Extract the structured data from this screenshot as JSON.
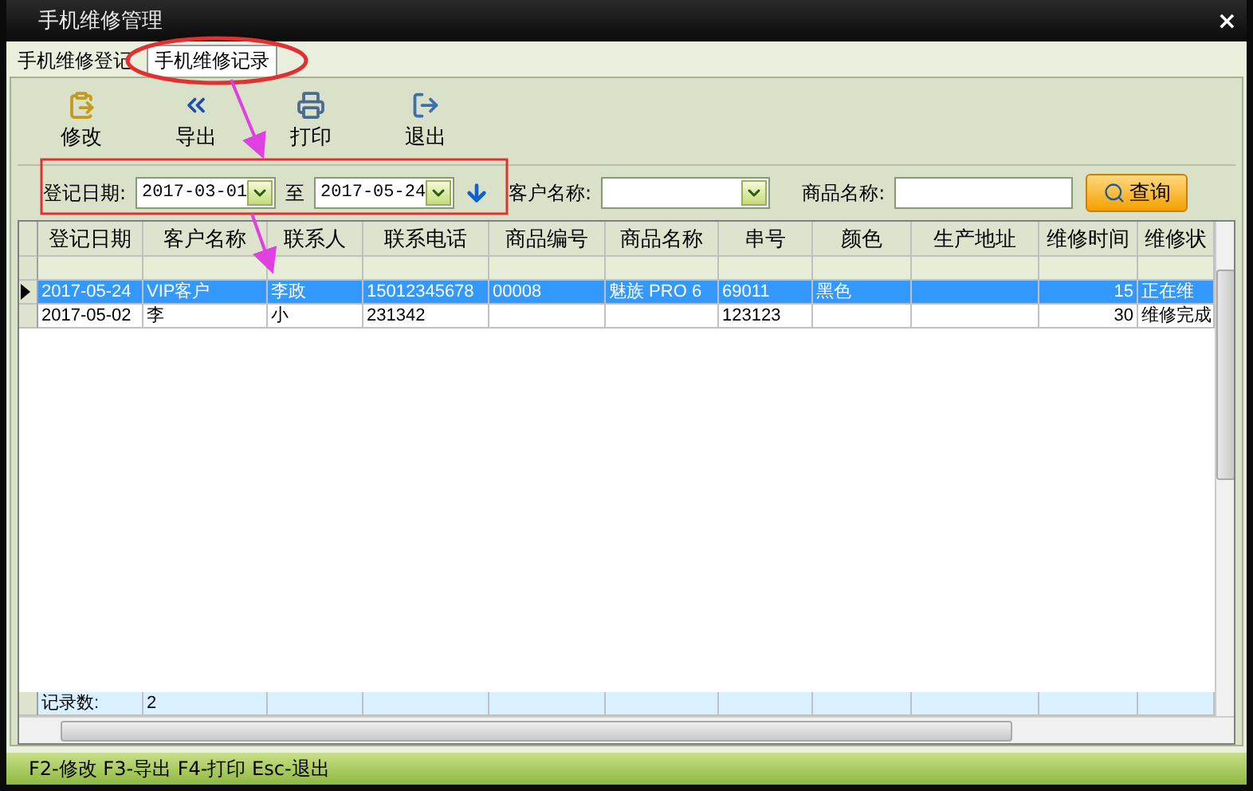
{
  "window": {
    "title": "手机维修管理",
    "close": "×"
  },
  "tabs": [
    {
      "label": "手机维修登记",
      "selected": false
    },
    {
      "label": "手机维修记录",
      "selected": true
    }
  ],
  "toolbar": [
    {
      "kind": "edit",
      "label": "修改"
    },
    {
      "kind": "export",
      "label": "导出"
    },
    {
      "kind": "print",
      "label": "打印"
    },
    {
      "kind": "exit",
      "label": "退出"
    }
  ],
  "filter": {
    "date_label": "登记日期:",
    "date_from": "2017-03-01",
    "to_label": "至",
    "date_to": "2017-05-24",
    "customer_label": "客户名称:",
    "product_label": "商品名称:",
    "search_button": "查询"
  },
  "table": {
    "columns": [
      "登记日期",
      "客户名称",
      "联系人",
      "联系电话",
      "商品编号",
      "商品名称",
      "串号",
      "颜色",
      "生产地址",
      "维修时间",
      "维修状"
    ],
    "rows": [
      {
        "selected": true,
        "cells": [
          "2017-05-24",
          "VIP客户",
          "李政",
          "15012345678",
          "00008",
          "魅族 PRO 6",
          "69011",
          "黑色",
          "",
          "15",
          "正在维"
        ]
      },
      {
        "selected": false,
        "cells": [
          "2017-05-02",
          "李",
          "小",
          "231342",
          "",
          "",
          "123123",
          "",
          "",
          "30",
          "维修完成"
        ]
      }
    ],
    "footer": {
      "label": "记录数:",
      "value": "2"
    }
  },
  "status_bar": "F2-修改 F3-导出 F4-打印 Esc-退出"
}
